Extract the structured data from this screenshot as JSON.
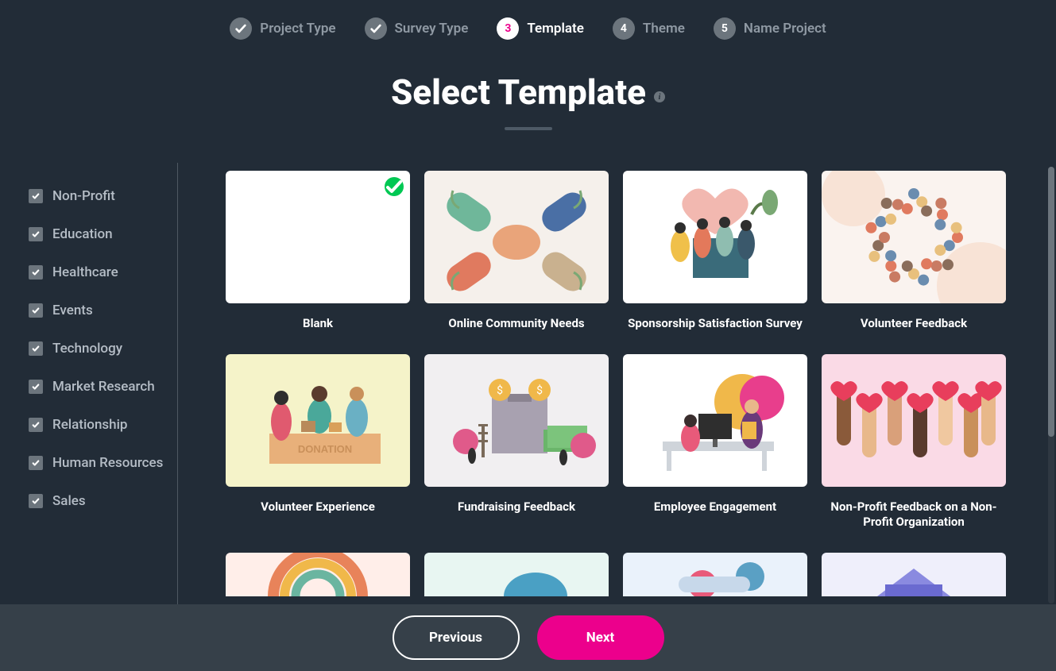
{
  "stepper": [
    {
      "label": "Project Type",
      "state": "done"
    },
    {
      "label": "Survey Type",
      "state": "done"
    },
    {
      "label": "Template",
      "state": "active",
      "num": "3"
    },
    {
      "label": "Theme",
      "state": "todo",
      "num": "4"
    },
    {
      "label": "Name Project",
      "state": "todo",
      "num": "5"
    }
  ],
  "title": "Select Template",
  "sidebar": {
    "categories": [
      {
        "label": "Non-Profit",
        "checked": true
      },
      {
        "label": "Education",
        "checked": true
      },
      {
        "label": "Healthcare",
        "checked": true
      },
      {
        "label": "Events",
        "checked": true
      },
      {
        "label": "Technology",
        "checked": true
      },
      {
        "label": "Market Research",
        "checked": true
      },
      {
        "label": "Relationship",
        "checked": true
      },
      {
        "label": "Human Resources",
        "checked": true
      },
      {
        "label": "Sales",
        "checked": true
      }
    ]
  },
  "templates": [
    {
      "title": "Blank",
      "variant": "blank",
      "selected": true
    },
    {
      "title": "Online Community Needs",
      "variant": "community",
      "selected": false
    },
    {
      "title": "Sponsorship Satisfaction Survey",
      "variant": "sponsorship",
      "selected": false
    },
    {
      "title": "Volunteer Feedback",
      "variant": "volfb",
      "selected": false
    },
    {
      "title": "Volunteer Experience",
      "variant": "volexp",
      "selected": false
    },
    {
      "title": "Fundraising Feedback",
      "variant": "fund",
      "selected": false
    },
    {
      "title": "Employee Engagement",
      "variant": "empeng",
      "selected": false
    },
    {
      "title": "Non-Profit Feedback on a Non-Profit Organization",
      "variant": "npfb",
      "selected": false
    },
    {
      "title": "",
      "variant": "r3a",
      "selected": false
    },
    {
      "title": "",
      "variant": "r3b",
      "selected": false
    },
    {
      "title": "",
      "variant": "r3c",
      "selected": false
    },
    {
      "title": "",
      "variant": "r3d",
      "selected": false
    }
  ],
  "footer": {
    "prev": "Previous",
    "next": "Next"
  }
}
